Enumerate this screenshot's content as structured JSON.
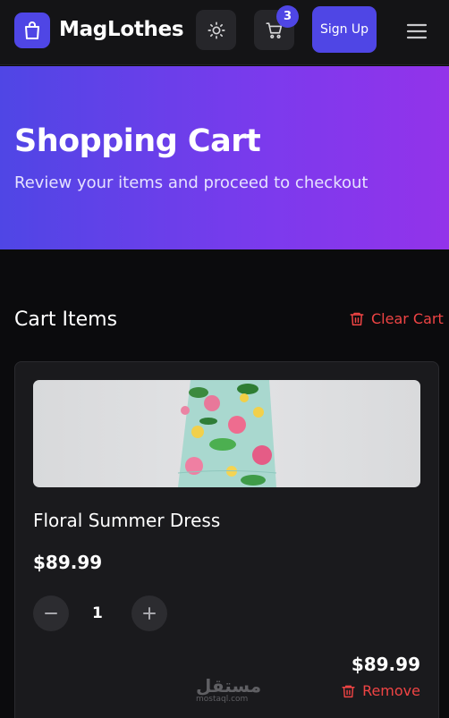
{
  "header": {
    "brand": "MagLothes",
    "logo_icon": "shopping-bag-icon",
    "theme_icon": "sun-icon",
    "cart_icon": "cart-icon",
    "cart_count": "3",
    "signup_label": "Sign Up",
    "menu_icon": "hamburger-menu-icon"
  },
  "hero": {
    "title": "Shopping Cart",
    "subtitle": "Review your items and proceed to checkout"
  },
  "cart": {
    "section_title": "Cart Items",
    "clear_label": "Clear Cart",
    "items": [
      {
        "name": "Floral Summer Dress",
        "price": "$89.99",
        "quantity": "1",
        "line_total": "$89.99",
        "remove_label": "Remove"
      }
    ]
  },
  "watermark": {
    "main": "مستقل",
    "sub": "mostaql.com"
  },
  "colors": {
    "accent": "#4f46e5",
    "danger": "#ef4444",
    "hero_gradient_start": "#4f46e5",
    "hero_gradient_end": "#9333ea",
    "background": "#0b0b0d"
  }
}
